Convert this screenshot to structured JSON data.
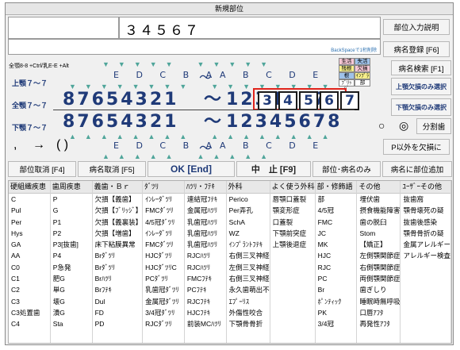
{
  "window": {
    "title": "新規部位"
  },
  "code_display": {
    "digits": "３４５６７",
    "backspace_hint": "BackSpaceで1桁削除"
  },
  "buttons": {
    "region_input_help": "部位入力説明",
    "name_register": "病名登録 [F6]",
    "name_search": "病名検索 [F1]",
    "upper_missing_only": "上顎欠損のみ選択",
    "lower_missing_only": "下顎欠損のみ選択",
    "split_teeth": "分割歯",
    "p_missing": "P以外を欠損に",
    "cancel_region": "部位取消 [F4]",
    "cancel_name": "病名取消 [F5]",
    "ok": "OK [End]",
    "abort": "中　止 [F9]",
    "region_name_only": "部位･病名のみ",
    "add_region_to_name": "病名に部位追加"
  },
  "shortcut_hint": "全顎8-8 +Ctrl/乳E-E +Alt",
  "row_labels": {
    "upper": "上顎７～７",
    "full": "全顎７～７",
    "lower": "下顎７～７"
  },
  "primary_upper": {
    "right": "E D C B A",
    "left": "A B C D E"
  },
  "primary_lower": {
    "right": "E D C B A",
    "left": "A B C D E"
  },
  "permanent_upper": {
    "right": "87654321",
    "tilde": "～",
    "left": "12345678"
  },
  "permanent_lower": {
    "right": "87654321",
    "tilde": "～",
    "left": "12345678"
  },
  "selected_teeth": [
    "3",
    "4",
    "5",
    "6",
    "7"
  ],
  "radio_symbols": [
    "○",
    "◎"
  ],
  "symbols": {
    "comma": ",",
    "arrow": "→",
    "parens": "( )"
  },
  "legend": [
    "生活",
    "失活",
    "残根",
    "欠損",
    "根",
    "ｲﾝﾌﾟﾗ",
    "ﾌﾞﾘｯｼﾞ",
    "部"
  ],
  "colors": {
    "selection_border": "#e0241c",
    "tooth_text": "#1f3a78",
    "marker": "#4fa59a",
    "legend_pink": "#f7c8d6",
    "legend_blue": "#9fc2ea",
    "legend_yellow": "#f6ee8a"
  },
  "columns": [
    {
      "header": "硬組織疾患",
      "items": [
        "C",
        "Pul",
        "Per",
        "Hys",
        "GA",
        "AA",
        "C0",
        "C1",
        "C2",
        "C3",
        "C3処置歯",
        "C4"
      ]
    },
    {
      "header": "歯周疾患",
      "items": [
        "P",
        "G",
        "P1",
        "P2",
        "P3[抜歯]",
        "P4",
        "P急発",
        "肥G",
        "単G",
        "壊G",
        "潰G",
        "Sta"
      ]
    },
    {
      "header": "義歯・Ｂｒ",
      "items": [
        "欠損【義歯】",
        "欠損【ﾌﾞﾘｯｼﾞ】",
        "欠損【義裏装】",
        "欠損【増歯】",
        "床下粘膜異常",
        "Brﾀﾞﾂﾘ",
        "Brﾀﾞﾂﾘ",
        "Brﾊﾂﾘ",
        "Brﾌﾃｷ",
        "Dul",
        "FD",
        "PD"
      ]
    },
    {
      "header": "ﾀﾞﾂﾘ",
      "items": [
        "ｲﾝﾚｰﾀﾞﾂﾘ",
        "FMCﾀﾞﾂﾘ",
        "4/5冠ﾀﾞﾂﾘ",
        "ｲﾝﾚｰﾀﾞﾂﾘ",
        "FMCﾀﾞﾂﾘ",
        "HJCﾀﾞﾂﾘ",
        "HJCﾀﾞﾂﾘC",
        "PCﾀﾞﾂﾘ",
        "乳歯冠ﾀﾞﾂﾘ",
        "金属冠ﾀﾞﾂﾘ",
        "3/4冠ﾀﾞﾂﾘ",
        "RJCﾀﾞﾂﾘ"
      ]
    },
    {
      "header": "ﾊﾂﾘ・ﾌﾃｷ",
      "items": [
        "連結冠ﾌﾃｷ",
        "金属冠ﾊﾂﾘ",
        "乳歯冠ﾊﾂﾘ",
        "乳歯冠ﾊﾂﾘ",
        "乳歯冠ﾊﾂﾘ",
        "RJCﾊﾂﾘ",
        "RJCﾊﾂﾘ",
        "FMCﾌﾃｷ",
        "PCﾌﾃｷ",
        "RJCﾌﾃｷ",
        "HJCﾌﾃｷ",
        "前装MCﾊﾂﾘ"
      ]
    },
    {
      "header": "外科",
      "items": [
        "Perico",
        "Per弄孔",
        "SchA",
        "WZ",
        "ｲﾝﾌﾟﾗﾝﾄﾌﾃｷ",
        "右側三叉神経",
        "左側三叉神経",
        "右側三叉神経",
        "永久歯萌出不",
        "ｴﾌﾟｰﾘｽ",
        "外傷性咬合",
        "下顎骨骨折"
      ]
    },
    {
      "header": "よく使う外科",
      "items": [
        "唇顎口蓋裂",
        "顎変形症",
        "口蓋裂",
        "下顎前突症",
        "上顎後退症",
        "",
        "",
        "",
        "",
        "",
        "",
        ""
      ]
    },
    {
      "header": "部・修飾語",
      "items": [
        "部",
        "4/5冠",
        "FMC",
        "JC",
        "MK",
        "HJC",
        "RJC",
        "PC",
        "Br",
        "ﾎﾟﾝﾃｨｯｸ",
        "PK",
        "3/4冠"
      ]
    },
    {
      "header": "その他",
      "items": [
        "埋伏歯",
        "摂食機能障害",
        "歯の脱臼",
        "Stom",
        "【矯正】",
        "左側顎関節症",
        "右側顎関節症",
        "両側顎関節症",
        "歯ぎしり",
        "睡眠時無呼吸",
        "口唇ｱﾌﾀ",
        "再発性ｱﾌﾀ"
      ]
    },
    {
      "header": "ﾕｰｻﾞｰその他",
      "items": [
        "抜歯窩",
        "顎骨壊死の疑",
        "抜歯後感染",
        "顎骨骨折の疑",
        "金属アレルギー",
        "アレルギー検査",
        "",
        "",
        "",
        "",
        "",
        ""
      ]
    }
  ]
}
